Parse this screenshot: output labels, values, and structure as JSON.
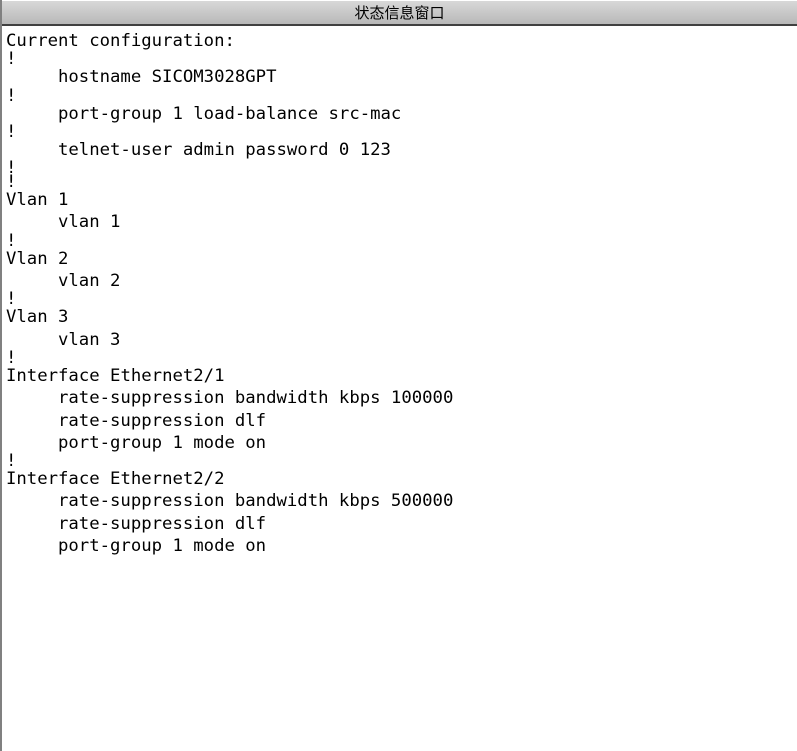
{
  "window": {
    "title": "状态信息窗口"
  },
  "console": {
    "lines": [
      {
        "text": "Current configuration:",
        "indent": false
      },
      {
        "text": "!",
        "indent": false
      },
      {
        "text": "hostname SICOM3028GPT",
        "indent": true
      },
      {
        "text": "!",
        "indent": false
      },
      {
        "text": "port-group 1 load-balance src-mac",
        "indent": true
      },
      {
        "text": "!",
        "indent": false
      },
      {
        "text": "telnet-user admin password 0 123",
        "indent": true
      },
      {
        "text": "!",
        "indent": false
      },
      {
        "text": "!",
        "indent": false
      },
      {
        "text": "Vlan 1",
        "indent": false
      },
      {
        "text": "vlan 1",
        "indent": true
      },
      {
        "text": "!",
        "indent": false
      },
      {
        "text": "Vlan 2",
        "indent": false
      },
      {
        "text": "vlan 2",
        "indent": true
      },
      {
        "text": "!",
        "indent": false
      },
      {
        "text": "Vlan 3",
        "indent": false
      },
      {
        "text": "vlan 3",
        "indent": true
      },
      {
        "text": "!",
        "indent": false
      },
      {
        "text": "Interface Ethernet2/1",
        "indent": false
      },
      {
        "text": "rate-suppression bandwidth kbps 100000",
        "indent": true
      },
      {
        "text": "rate-suppression dlf",
        "indent": true
      },
      {
        "text": "port-group 1 mode on",
        "indent": true
      },
      {
        "text": "!",
        "indent": false
      },
      {
        "text": "Interface Ethernet2/2",
        "indent": false
      },
      {
        "text": "rate-suppression bandwidth kbps 500000",
        "indent": true
      },
      {
        "text": "rate-suppression dlf",
        "indent": true
      },
      {
        "text": "port-group 1 mode on",
        "indent": true
      }
    ]
  }
}
